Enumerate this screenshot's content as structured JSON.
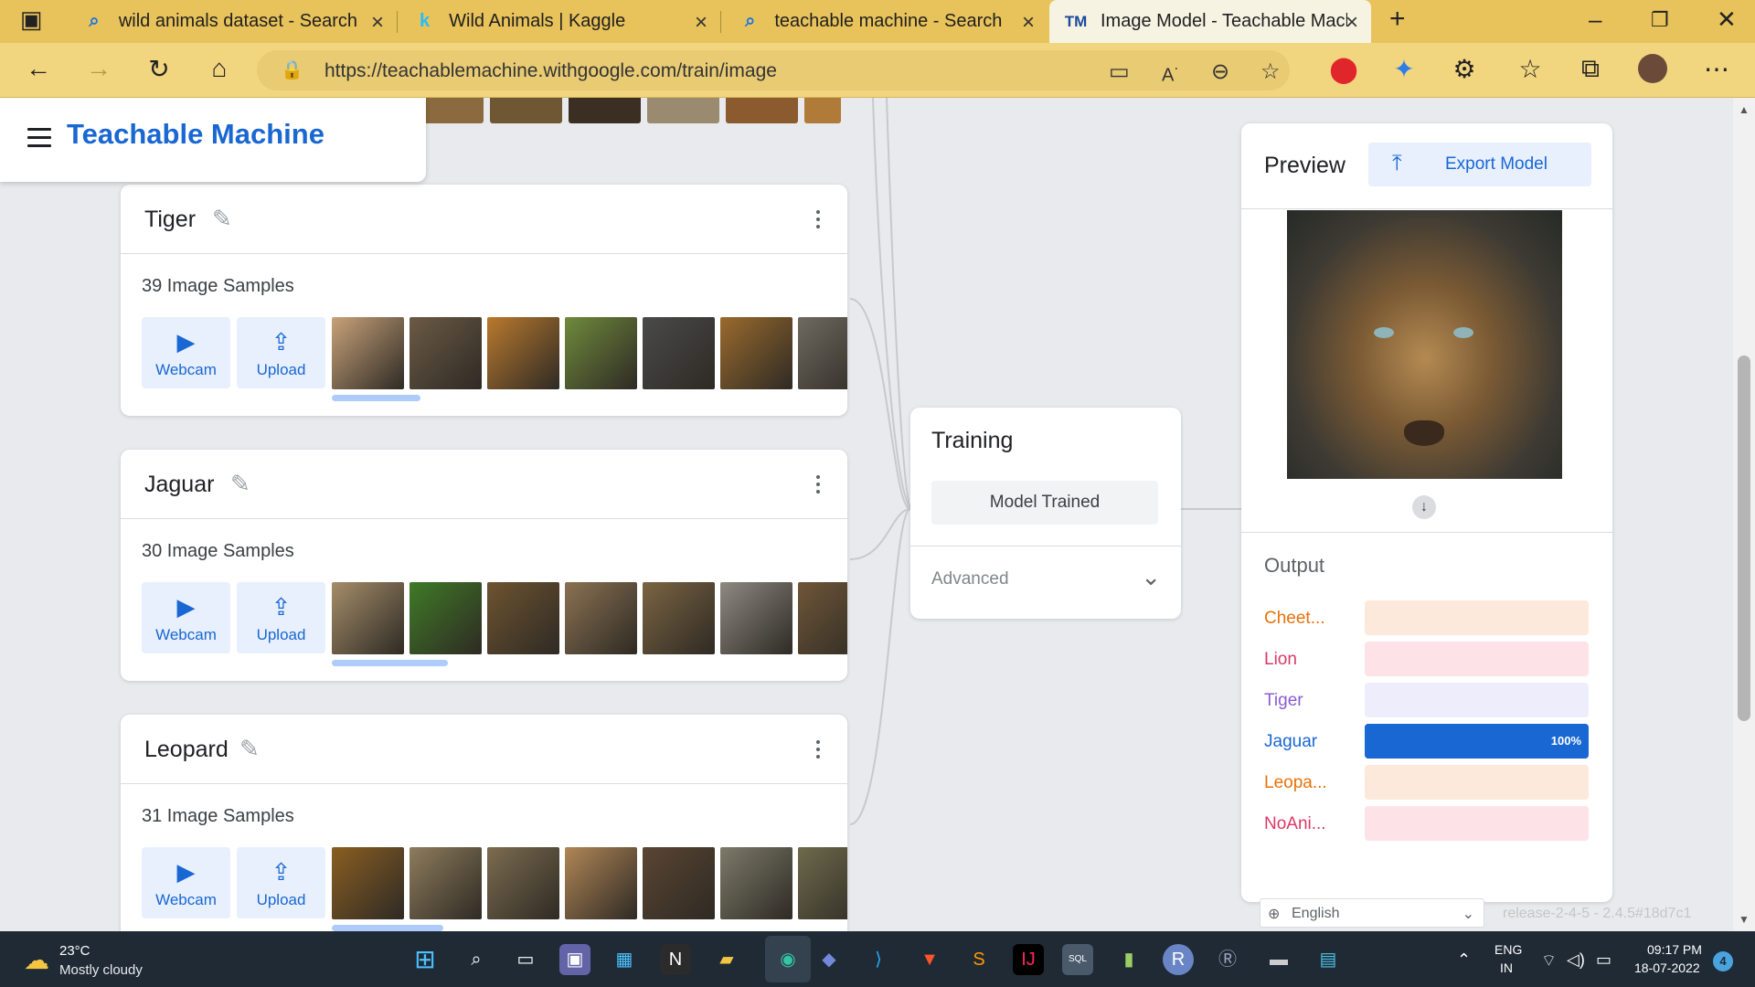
{
  "browser": {
    "tabs": [
      {
        "icon": "search-icon",
        "title": "wild animals dataset - Search",
        "active": false
      },
      {
        "icon": "kaggle-icon",
        "title": "Wild Animals | Kaggle",
        "active": false
      },
      {
        "icon": "search-icon",
        "title": "teachable machine - Search",
        "active": false
      },
      {
        "icon": "teachable-machine-icon",
        "title": "Image Model - Teachable Machine",
        "active": true
      }
    ],
    "url": "https://teachablemachine.withgoogle.com/train/image",
    "accent": "#e8c25a"
  },
  "app": {
    "brand": "Teachable Machine",
    "brand_color": "#1967d2"
  },
  "classes": [
    {
      "name": "Tiger",
      "samples": "39 Image Samples",
      "webcam_label": "Webcam",
      "upload_label": "Upload",
      "thumb_colors": [
        "#c8a27a",
        "#6b5a45",
        "#b9792e",
        "#6f8a3c",
        "#4a4a4a",
        "#9a6a2e",
        "#6e6a60"
      ]
    },
    {
      "name": "Jaguar",
      "samples": "30 Image Samples",
      "webcam_label": "Webcam",
      "upload_label": "Upload",
      "thumb_colors": [
        "#a58d6a",
        "#3f7a26",
        "#6e5330",
        "#8a7252",
        "#7b6442",
        "#8e8a82",
        "#6f5638"
      ]
    },
    {
      "name": "Leopard",
      "samples": "31 Image Samples",
      "webcam_label": "Webcam",
      "upload_label": "Upload",
      "thumb_colors": [
        "#8a5e22",
        "#8e7c5c",
        "#7c6c50",
        "#b08656",
        "#5a4532",
        "#7d7a6a",
        "#6e6a4c"
      ]
    }
  ],
  "training": {
    "title": "Training",
    "button": "Model Trained",
    "advanced": "Advanced"
  },
  "preview": {
    "title": "Preview",
    "export_label": "Export Model",
    "output_title": "Output",
    "outputs": [
      {
        "label": "Cheet...",
        "color": "#e8710a",
        "track": "#fde8dc",
        "value": 0
      },
      {
        "label": "Lion",
        "color": "#d93968",
        "track": "#fde3e8",
        "value": 0
      },
      {
        "label": "Tiger",
        "color": "#8a5cd0",
        "track": "#eeedfc",
        "value": 0
      },
      {
        "label": "Jaguar",
        "color": "#1967d2",
        "track": "#1967d2",
        "value": 100,
        "pct": "100%"
      },
      {
        "label": "Leopa...",
        "color": "#e8710a",
        "track": "#fde8dc",
        "value": 0
      },
      {
        "label": "NoAni...",
        "color": "#d93968",
        "track": "#fde3e8",
        "value": 0
      }
    ]
  },
  "footer": {
    "language": "English",
    "release": "release-2-4-5 - 2.4.5#18d7c1"
  },
  "taskbar": {
    "temp": "23°C",
    "weather": "Mostly cloudy",
    "lang1": "ENG",
    "lang2": "IN",
    "time": "09:17 PM",
    "date": "18-07-2022",
    "notifications": "4"
  }
}
